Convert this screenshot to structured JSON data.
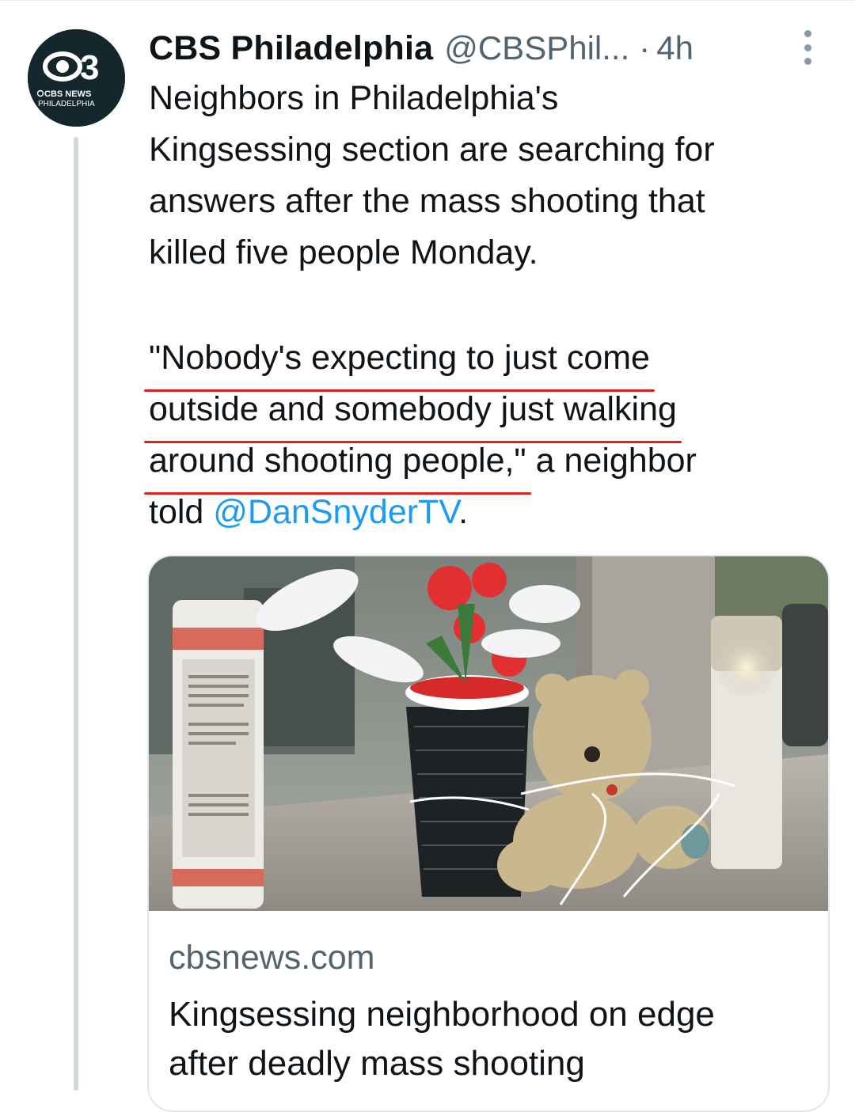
{
  "account": {
    "display_name": "CBS Philadelphia",
    "handle": "@CBSPhil...",
    "separator": "·",
    "time_ago": "4h",
    "avatar": {
      "number": "3",
      "network": "CBS NEWS",
      "city": "PHILADELPHIA"
    }
  },
  "tweet": {
    "intro_lines": [
      "Neighbors in Philadelphia's",
      "Kingsessing section are searching for",
      "answers after the mass shooting that",
      "killed five people Monday."
    ],
    "quote_line_1": "\"Nobody's expecting to just come",
    "quote_line_2": "outside and somebody just walking",
    "quote_line_3_underlined": "around shooting people,\"",
    "quote_line_3_rest": " a neighbor",
    "quote_line_4_prefix": "told ",
    "mention": "@DanSnyderTV",
    "quote_line_4_suffix": "."
  },
  "card": {
    "domain": "cbsnews.com",
    "title_line_1": "Kingsessing neighborhood on edge",
    "title_line_2": "after deadly mass shooting"
  },
  "colors": {
    "link": "#1d9bf0",
    "secondary_text": "#536471",
    "annotation_underline": "#e0201a",
    "avatar_bg": "#13272d"
  }
}
